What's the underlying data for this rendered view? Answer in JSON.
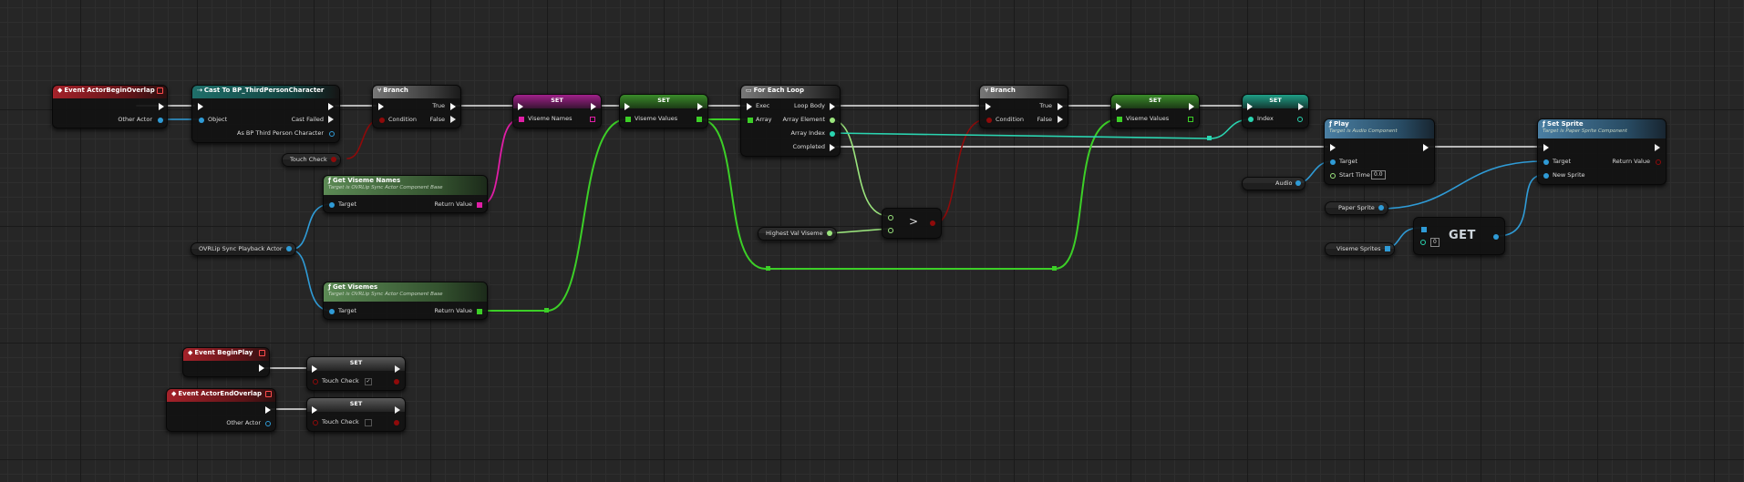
{
  "colors": {
    "exec": "#ffffff",
    "object": "#2f9bd6",
    "bool": "#8f0a0a",
    "array_green": "#3ccf27",
    "array_pink": "#e01ea6",
    "int": "#2ad4b0",
    "float_green": "#9be57d",
    "event_header": "#a4222a",
    "function_header": "#5c8a55",
    "audio_header": "#4a7fa3"
  },
  "nodes": {
    "event_begin_overlap": {
      "title": "Event ActorBeginOverlap",
      "other_actor": "Other Actor"
    },
    "cast": {
      "title": "Cast To BP_ThirdPersonCharacter",
      "object": "Object",
      "cast_failed": "Cast Failed",
      "as_char": "As BP Third Person Character"
    },
    "branch1": {
      "title": "Branch",
      "true": "True",
      "false": "False",
      "condition": "Condition"
    },
    "set_viseme_names": {
      "title": "SET",
      "pin": "Viseme Names"
    },
    "set_viseme_values1": {
      "title": "SET",
      "pin": "Viseme Values"
    },
    "for_each": {
      "title": "For Each Loop",
      "exec": "Exec",
      "loop_body": "Loop Body",
      "array": "Array",
      "array_element": "Array Element",
      "array_index": "Array Index",
      "completed": "Completed"
    },
    "branch2": {
      "title": "Branch",
      "true": "True",
      "false": "False",
      "condition": "Condition"
    },
    "set_viseme_values2": {
      "title": "SET",
      "pin": "Viseme Values"
    },
    "set_index": {
      "title": "SET",
      "pin": "Index"
    },
    "play": {
      "title": "Play",
      "subtitle": "Target is Audio Component",
      "target": "Target",
      "start_time": "Start Time",
      "start_time_value": "0.0"
    },
    "set_sprite": {
      "title": "Set Sprite",
      "subtitle": "Target is Paper Sprite Component",
      "target": "Target",
      "return_value": "Return Value",
      "new_sprite": "New Sprite"
    },
    "get_viseme_names": {
      "title": "Get Viseme Names",
      "subtitle": "Target is OVRLip Sync Actor Component Base",
      "target": "Target",
      "return_value": "Return Value"
    },
    "get_visemes": {
      "title": "Get Visemes",
      "subtitle": "Target is OVRLip Sync Actor Component Base",
      "target": "Target",
      "return_value": "Return Value"
    },
    "greater": {
      "symbol": ">"
    },
    "get_array": {
      "label": "GET",
      "index": "0"
    },
    "event_begin_play": {
      "title": "Event BeginPlay"
    },
    "set_touch_true": {
      "title": "SET",
      "pin": "Touch Check",
      "checked": "✓"
    },
    "event_end_overlap": {
      "title": "Event ActorEndOverlap",
      "other_actor": "Other Actor"
    },
    "set_touch_false": {
      "title": "SET",
      "pin": "Touch Check"
    }
  },
  "variables": {
    "touch_check": "Touch Check",
    "ovr_actor": "OVRLip Sync Playback Actor",
    "highest_val_viseme": "Highest Val Viseme",
    "audio": "Audio",
    "paper_sprite": "Paper Sprite",
    "viseme_sprites": "Viseme Sprites"
  }
}
